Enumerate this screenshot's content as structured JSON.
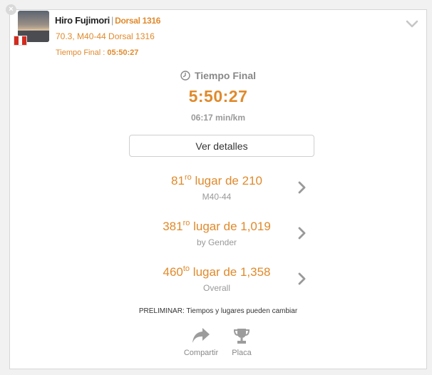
{
  "athlete": {
    "name": "Hiro Fujimori",
    "separator": "|",
    "bib": "Dorsal 1316",
    "info": "70.3, M40-44 Dorsal 1316",
    "final_label": "Tiempo Final :",
    "final_value": "05:50:27"
  },
  "result": {
    "label": "Tiempo Final",
    "time": "5:50:27",
    "pace": "06:17 min/km"
  },
  "details_button": "Ver detalles",
  "rankings": [
    {
      "position": "81",
      "suffix": "ro",
      "text": "lugar de 210",
      "category": "M40-44"
    },
    {
      "position": "381",
      "suffix": "ro",
      "text": "lugar de 1,019",
      "category": "by Gender"
    },
    {
      "position": "460",
      "suffix": "to",
      "text": "lugar de 1,358",
      "category": "Overall"
    }
  ],
  "note": "PRELIMINAR: Tiempos y lugares pueden cambiar",
  "actions": {
    "share": "Compartir",
    "plaque": "Placa"
  },
  "colors": {
    "accent": "#e08a2c",
    "muted": "#999999",
    "flag_red": "#d52b1e"
  },
  "icons": [
    "close-icon",
    "chevron-down-icon",
    "clock-icon",
    "chevron-right-icon",
    "share-icon",
    "trophy-icon",
    "flag-icon"
  ]
}
